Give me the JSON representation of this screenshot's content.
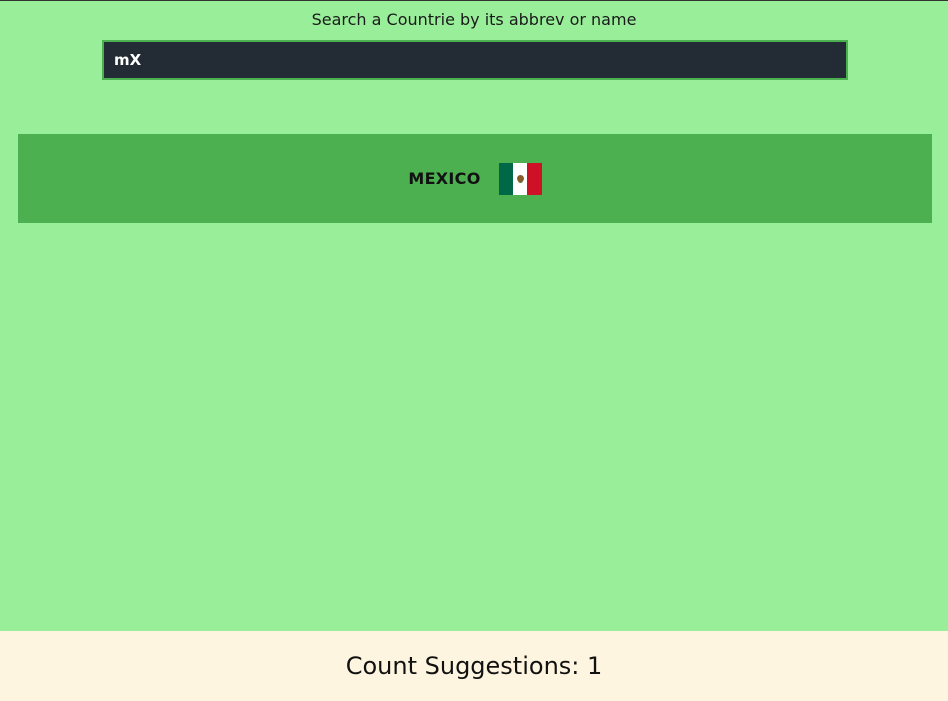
{
  "search": {
    "label": "Search a Countrie by its abbrev or name",
    "value": "mX"
  },
  "results": [
    {
      "name": "MEXICO",
      "flag_icon": "mexico-flag-icon",
      "flag_colors": [
        "#006847",
        "#ffffff",
        "#ce1126"
      ]
    }
  ],
  "footer": {
    "count_text": "Count Suggestions: 1"
  },
  "colors": {
    "page_background": "#99ef99",
    "result_background": "#4caf50",
    "input_background": "#232c34",
    "footer_background": "#fdf5df"
  }
}
